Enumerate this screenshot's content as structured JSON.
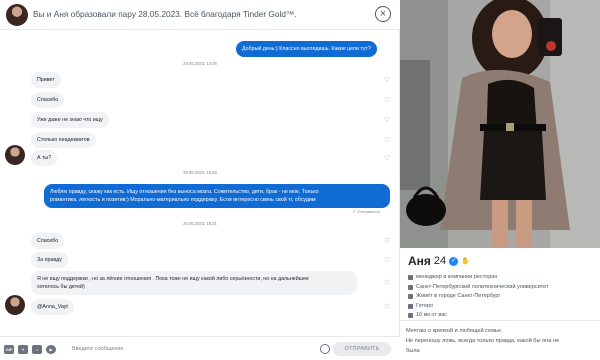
{
  "header": {
    "match_text": "Вы и Аня образовали пару 28.05.2023. Всё благодаря Tinder Gold™."
  },
  "messages": [
    {
      "kind": "me",
      "text": "Добрый день:) Классно выглядишь. Какие цели тут?"
    },
    {
      "kind": "timestamp",
      "text": "29.05.2023, 14:09"
    },
    {
      "kind": "them",
      "text": "Привет"
    },
    {
      "kind": "them",
      "text": "Спасибо"
    },
    {
      "kind": "them",
      "text": "Уже даже не знаю что ищу"
    },
    {
      "kind": "them",
      "text": "Столько неадекватов"
    },
    {
      "kind": "them",
      "text": "А ты?"
    },
    {
      "kind": "timestamp",
      "text": "30.05.2023, 16:56"
    },
    {
      "kind": "me",
      "lines": [
        "Люблю правду, скажу как есть. Ищу отношения без выноса мозга. Сожительство, дети, брак - не мое. Только",
        "романтика, легкость и позитив:) Морально-материально поддержку. Если интересно скинь свой тг, обсудим"
      ]
    },
    {
      "kind": "status",
      "text": "Отправлено"
    },
    {
      "kind": "timestamp",
      "text": "30.05.2023, 18:31"
    },
    {
      "kind": "them",
      "text": "Спасибо"
    },
    {
      "kind": "them",
      "text": "За правду"
    },
    {
      "kind": "them",
      "lines": [
        "Я не ищу поддержки , но за лёгкие отношения . Пока тоже не ищу какой либо серьёзности, но на дальнейшее",
        "хотелось бы детей)"
      ]
    },
    {
      "kind": "them",
      "text": "@Anna_Vayt"
    }
  ],
  "input": {
    "placeholder": "Введите сообщение",
    "send_label": "ОТПРАВИТЬ",
    "gif_label": "GIF"
  },
  "profile": {
    "name": "Аня",
    "age": "24",
    "details": [
      "менеджер в компании ресторан",
      "Санкт-Петербургский политехнический университет",
      "Живёт в городе Санкт-Петербург",
      "Гетеро",
      "10 км от вас"
    ],
    "bio": [
      "Мечтаю о крепкой и любящей семье.",
      "Не переношу ложь, всегда только правда, какой бы она не",
      "была"
    ]
  },
  "colors": {
    "accent": "#106bd5",
    "verified": "#1786ff"
  }
}
